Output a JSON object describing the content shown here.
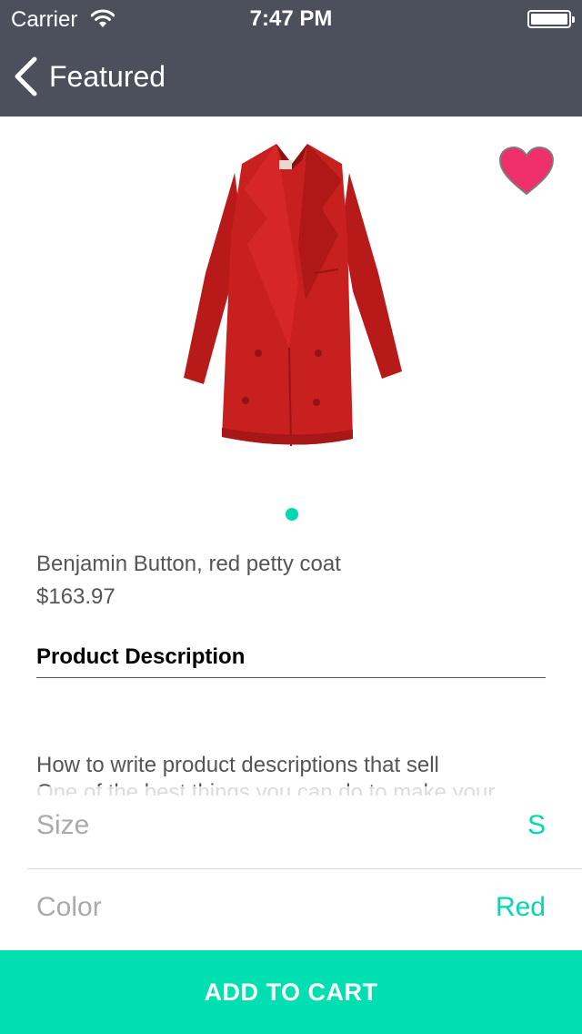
{
  "status_bar": {
    "carrier": "Carrier",
    "time": "7:47 PM"
  },
  "nav": {
    "back_label": "Featured"
  },
  "product": {
    "name": "Benjamin Button, red petty coat",
    "price": "$163.97",
    "image": "red-coat-image",
    "favorite": true,
    "page_indicator": {
      "current": 1,
      "total": 1
    }
  },
  "description": {
    "heading": "Product Description",
    "line1": "How to write product descriptions that sell",
    "line2": "One of the best things you can do to make your"
  },
  "options": {
    "size_label": "Size",
    "size_value": "S",
    "color_label": "Color",
    "color_value": "Red"
  },
  "cart_button": "ADD TO CART",
  "colors": {
    "nav_bg": "#4b505c",
    "accent": "#00d9b1",
    "heart": "#ee2f6b",
    "coat": "#c81f1f"
  }
}
